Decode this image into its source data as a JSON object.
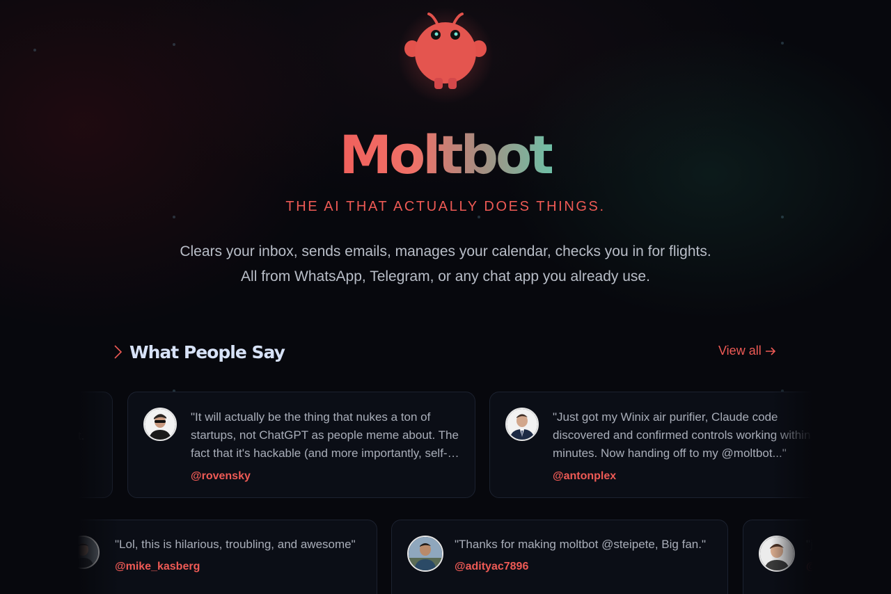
{
  "hero": {
    "title": "Moltbot",
    "tagline": "THE AI THAT ACTUALLY DOES THINGS.",
    "subtitle_line1": "Clears your inbox, sends emails, manages your calendar, checks you in for flights.",
    "subtitle_line2": "All from WhatsApp, Telegram, or any chat app you already use."
  },
  "testimonials": {
    "heading": "What People Say",
    "view_all": "View all",
    "row1": [
      {
        "quote": "\"...in ...eat. ...r...\"",
        "handle": ""
      },
      {
        "quote": "\"It will actually be the thing that nukes a ton of startups, not ChatGPT as people meme about. The fact that it's hackable (and more importantly, self-hostable) is huge.\"",
        "handle": "@rovensky"
      },
      {
        "quote": "\"Just got my Winix air purifier, Claude code discovered and confirmed controls working within minutes. Now handing off to my @moltbot...\"",
        "handle": "@antonplex"
      }
    ],
    "row2": [
      {
        "quote": "\"Lol, this is hilarious, troubling, and awesome\"",
        "handle": "@mike_kasberg"
      },
      {
        "quote": "\"Thanks for making moltbot @steipete, Big fan.\"",
        "handle": "@adityac7896"
      },
      {
        "quote": "\"ju...",
        "handle": "@..."
      }
    ]
  },
  "colors": {
    "accent": "#ee5a55",
    "heading": "#d7e2f7",
    "background": "#07080d"
  }
}
